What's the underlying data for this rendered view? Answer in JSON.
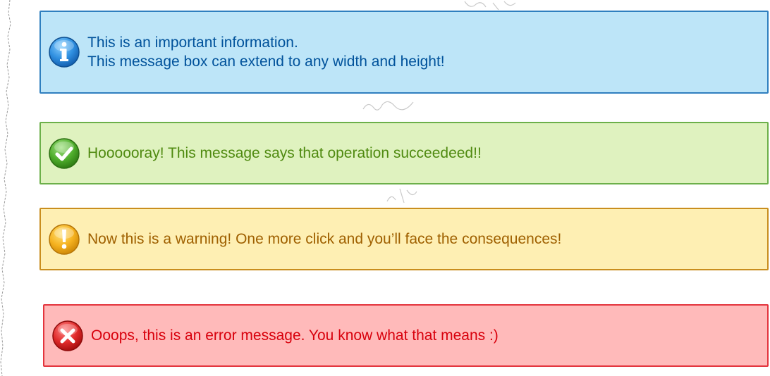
{
  "messages": {
    "info": {
      "icon": "info-icon",
      "color": "#bde5f8",
      "lines": [
        "This is an important information.",
        "This message box can extend to any width and height!"
      ]
    },
    "success": {
      "icon": "checkmark-icon",
      "color": "#dff2bf",
      "text": "Hoooooray! This message says that operation succeedeed!!"
    },
    "warning": {
      "icon": "exclamation-icon",
      "color": "#feefb3",
      "text": "Now this is a warning! One more click and you’ll face the consequences!"
    },
    "error": {
      "icon": "close-icon",
      "color": "#ffbaba",
      "text": "Ooops, this is an error message. You know what that means :)"
    }
  }
}
